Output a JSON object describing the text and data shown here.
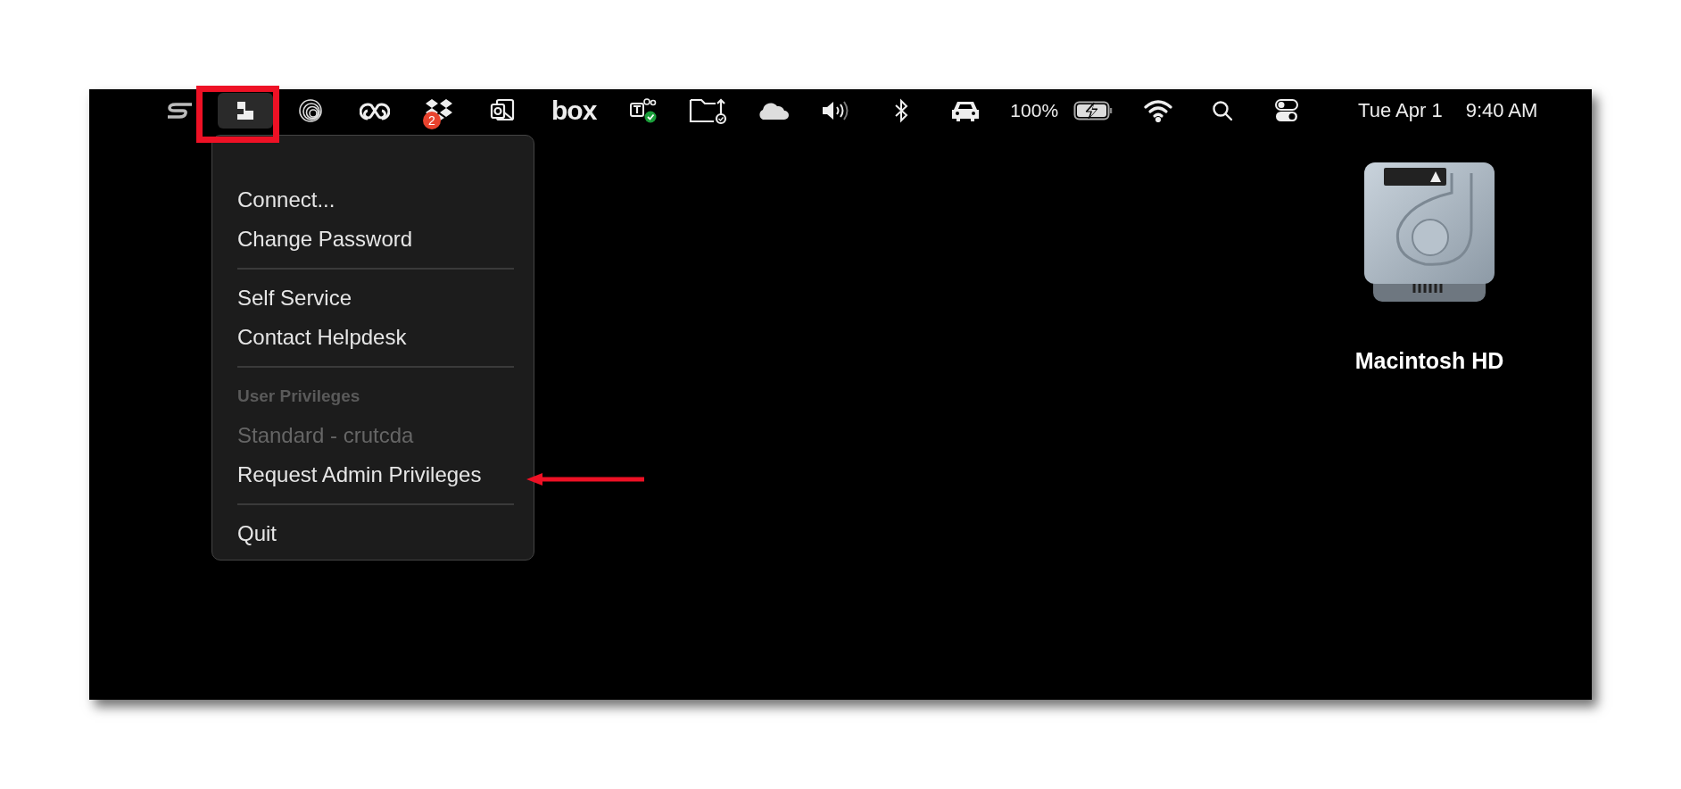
{
  "menu_bar": {
    "status_items": [
      {
        "kind": "s-logo",
        "selected": false
      },
      {
        "kind": "app",
        "selected": true
      },
      {
        "kind": "rings",
        "selected": false
      },
      {
        "kind": "creative-cloud",
        "selected": false
      },
      {
        "kind": "dropbox",
        "selected": false,
        "badge": "2"
      },
      {
        "kind": "outlook",
        "selected": false
      },
      {
        "kind": "logo-text",
        "selected": false,
        "text": "box"
      },
      {
        "kind": "teams",
        "selected": false
      },
      {
        "kind": "folder",
        "selected": false
      },
      {
        "kind": "cloud",
        "selected": false
      },
      {
        "kind": "volume",
        "selected": false
      },
      {
        "kind": "bluetooth",
        "selected": false
      },
      {
        "kind": "car",
        "selected": false
      },
      {
        "kind": "text",
        "selected": false,
        "text": "100%"
      },
      {
        "kind": "battery",
        "selected": false
      },
      {
        "kind": "wifi",
        "selected": false
      },
      {
        "kind": "search",
        "selected": false
      },
      {
        "kind": "control-center",
        "selected": false
      }
    ],
    "date": "Tue Apr 1",
    "time": "9:40 AM"
  },
  "menu": {
    "items": [
      {
        "kind": "item",
        "label": "Connect...",
        "disabled": false
      },
      {
        "kind": "item",
        "label": "Change Password",
        "disabled": false
      },
      {
        "kind": "separator"
      },
      {
        "kind": "item",
        "label": "Self Service",
        "disabled": false
      },
      {
        "kind": "item",
        "label": "Contact Helpdesk",
        "disabled": false
      },
      {
        "kind": "separator"
      },
      {
        "kind": "header",
        "label": "User Privileges"
      },
      {
        "kind": "item",
        "label": "Standard - crutcda",
        "disabled": true
      },
      {
        "kind": "item",
        "label": "Request Admin Privileges",
        "disabled": false
      },
      {
        "kind": "separator"
      },
      {
        "kind": "item",
        "label": "Quit",
        "disabled": false
      }
    ]
  },
  "desktop": {
    "icons": [
      {
        "label": "Macintosh HD"
      }
    ]
  }
}
